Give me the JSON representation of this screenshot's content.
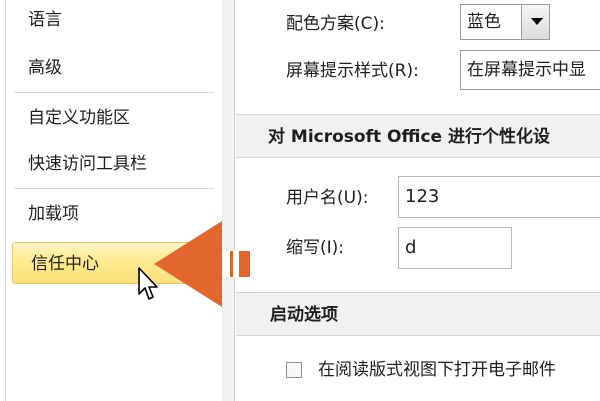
{
  "sidebar": {
    "items": [
      {
        "label": "语言"
      },
      {
        "label": "高级"
      },
      {
        "label": "自定义功能区"
      },
      {
        "label": "快速访问工具栏"
      },
      {
        "label": "加载项"
      },
      {
        "label": "信任中心",
        "selected": true
      }
    ]
  },
  "general": {
    "color_scheme_label": "配色方案(C):",
    "color_scheme_value": "蓝色",
    "screentip_label": "屏幕提示样式(R):",
    "screentip_value": "在屏幕提示中显"
  },
  "personalize": {
    "section_title": "对 Microsoft Office 进行个性化设",
    "username_label": "用户名(U):",
    "username_value": "123",
    "initials_label": "缩写(I):",
    "initials_value": "d"
  },
  "startup": {
    "section_title": "启动选项",
    "reading_view_label": "在阅读版式视图下打开电子邮件"
  },
  "icons": {
    "arrow": "left-arrow-icon",
    "cursor": "mouse-pointer-icon",
    "dropdown": "chevron-down-icon"
  },
  "colors": {
    "arrow": "#e2672e",
    "selected_bg": "#ffe98b"
  }
}
